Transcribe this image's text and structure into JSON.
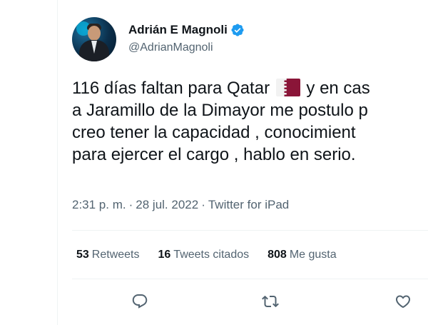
{
  "author": {
    "display_name": "Adrián E Magnoli",
    "handle": "@AdrianMagnoli",
    "verified": true
  },
  "tweet": {
    "lines": [
      {
        "before_flag": "116 días faltan para Qatar ",
        "flag": "qatar-flag-icon",
        "after_flag": " y en cas"
      },
      {
        "text": "a Jaramillo de la Dimayor me postulo p"
      },
      {
        "text": "creo tener la capacidad , conocimient"
      },
      {
        "text": "para ejercer el cargo , hablo en serio."
      }
    ]
  },
  "meta": {
    "time": "2:31 p. m.",
    "separator": "·",
    "date": "28 jul. 2022",
    "source": "Twitter for iPad"
  },
  "stats": {
    "retweets_count": "53",
    "retweets_label": "Retweets",
    "quotes_count": "16",
    "quotes_label": "Tweets citados",
    "likes_count": "808",
    "likes_label": "Me gusta"
  },
  "actions": [
    "reply-icon",
    "retweet-icon",
    "like-icon"
  ],
  "colors": {
    "text": "#0f1419",
    "secondary": "#536471",
    "verified": "#1d9bf0",
    "qatar_maroon": "#8a1538",
    "divider": "#eff3f4"
  }
}
